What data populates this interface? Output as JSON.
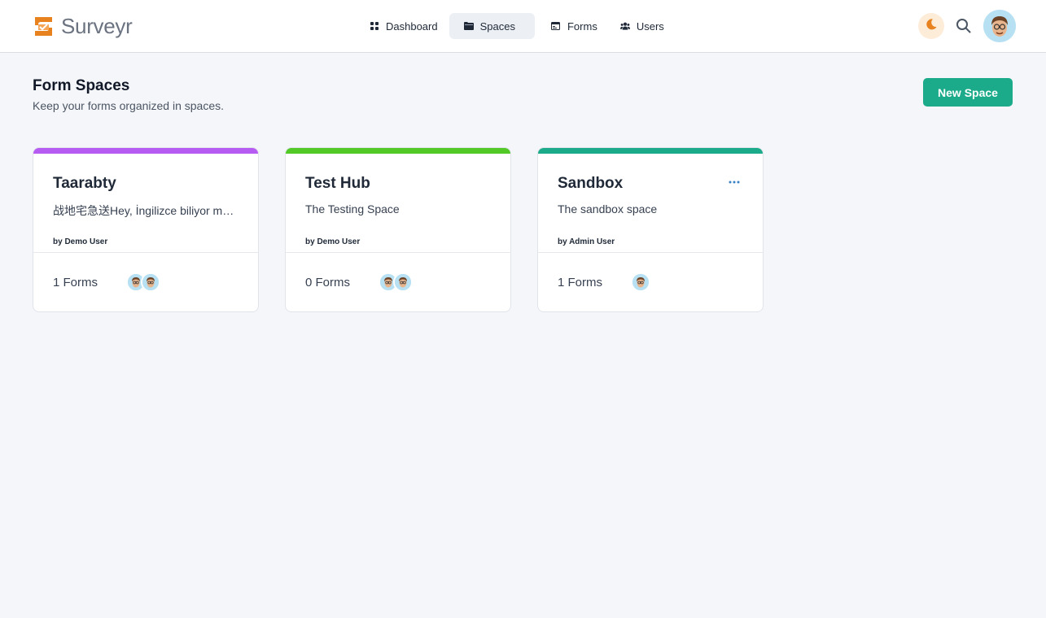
{
  "app": {
    "name": "Surveyr"
  },
  "nav": [
    {
      "label": "Dashboard",
      "icon": "grid-icon",
      "active": false
    },
    {
      "label": "Spaces",
      "icon": "folder-icon",
      "active": true
    },
    {
      "label": "Forms",
      "icon": "form-icon",
      "active": false
    },
    {
      "label": "Users",
      "icon": "users-icon",
      "active": false
    }
  ],
  "header": {
    "title": "Form Spaces",
    "subtitle": "Keep your forms organized in spaces.",
    "new_button": "New Space"
  },
  "colors": {
    "accent": "#1bab8a",
    "logo": "#e8821f",
    "purple": "#b75cf2",
    "green": "#53c928",
    "teal": "#1bab8a"
  },
  "spaces": [
    {
      "title": "Taarabty",
      "description": "战地宅急送Hey, İngilizce biliyor musun?",
      "owner": "by Demo User",
      "forms": "1 Forms",
      "members": 2,
      "bar_color": "#b75cf2",
      "has_menu": false
    },
    {
      "title": "Test Hub",
      "description": "The Testing Space",
      "owner": "by Demo User",
      "forms": "0 Forms",
      "members": 2,
      "bar_color": "#53c928",
      "has_menu": false
    },
    {
      "title": "Sandbox",
      "description": "The sandbox space",
      "owner": "by Admin User",
      "forms": "1 Forms",
      "members": 1,
      "bar_color": "#1bab8a",
      "has_menu": true
    }
  ]
}
